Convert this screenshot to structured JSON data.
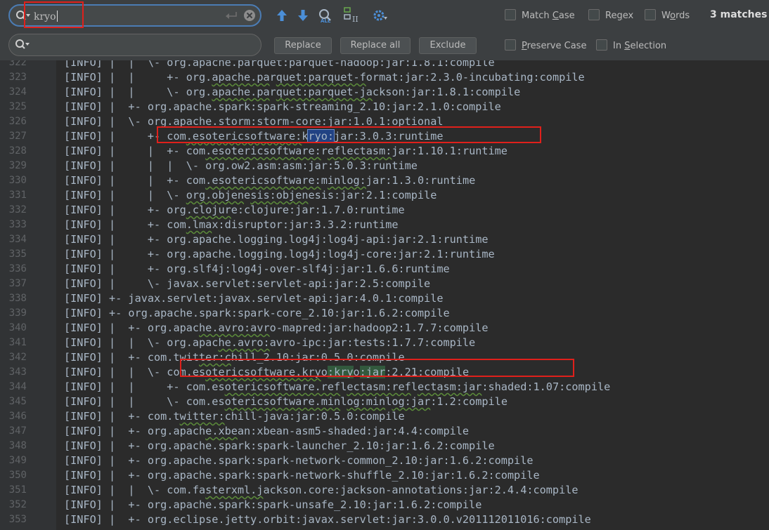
{
  "find": {
    "query": "kryo"
  },
  "buttons": {
    "replace": "Replace",
    "replace_all": "Replace all",
    "exclude": "Exclude"
  },
  "options": {
    "match_case": {
      "pre": "Match ",
      "key": "C",
      "post": "ase"
    },
    "regex": {
      "pre": "Re",
      "key": "g",
      "post": "ex"
    },
    "words": {
      "pre": "W",
      "key": "o",
      "post": "rds"
    },
    "preserve_case": {
      "pre": "",
      "key": "P",
      "post": "reserve Case"
    },
    "in_selection": {
      "pre": "In ",
      "key": "S",
      "post": "election"
    }
  },
  "matches_label": "3 matches",
  "colors": {
    "selection": "#214283",
    "match": "#32593d",
    "highlight_box": "#e0201b",
    "accent": "#4b7cb4"
  },
  "icons": [
    "search-icon",
    "clear-icon",
    "prev-occurrence-icon",
    "next-occurrence-icon",
    "find-all-icon",
    "select-all-occurrences-icon",
    "settings-icon"
  ],
  "lines": [
    {
      "n": "322",
      "t": "[INFO] |  |  \\- org.apache.parquet:parquet-hadoop:jar:1.8.1:compile",
      "sq": []
    },
    {
      "n": "323",
      "t": "[INFO] |  |     +- org.apache.parquet:parquet-format:jar:2.3.0-incubating:compile",
      "sq": [
        [
          23,
          32
        ],
        [
          33,
          47
        ]
      ]
    },
    {
      "n": "324",
      "t": "[INFO] |  |     \\- org.apache.parquet:parquet-jackson:jar:1.8.1:compile",
      "sq": [
        [
          23,
          32
        ],
        [
          33,
          48
        ]
      ]
    },
    {
      "n": "325",
      "t": "[INFO] |  +- org.apache.spark:spark-streaming_2.10:jar:2.1.0:compile",
      "sq": []
    },
    {
      "n": "326",
      "t": "[INFO] |  \\- org.apache.storm:storm-core:jar:1.0.1:optional",
      "sq": []
    },
    {
      "n": "327",
      "t": "[INFO] |     +- com.esotericsoftware:kryo:jar:3.0.3:runtime",
      "sq": [
        [
          19,
          37
        ]
      ],
      "hl": [
        [
          38,
          42,
          "sel"
        ]
      ]
    },
    {
      "n": "328",
      "t": "[INFO] |     |  +- com.esotericsoftware:reflectasm:jar:1.10.1:runtime",
      "sq": [
        [
          22,
          40
        ],
        [
          41,
          51
        ]
      ]
    },
    {
      "n": "329",
      "t": "[INFO] |     |  |  \\- org.ow2.asm:asm:jar:5.0.3:runtime",
      "sq": []
    },
    {
      "n": "330",
      "t": "[INFO] |     |  +- com.esotericsoftware:minlog:jar:1.3.0:runtime",
      "sq": [
        [
          22,
          40
        ],
        [
          41,
          47
        ]
      ]
    },
    {
      "n": "331",
      "t": "[INFO] |     |  \\- org.objenesis:objenesis:jar:2.1:compile",
      "sq": [
        [
          19,
          28
        ],
        [
          29,
          38
        ]
      ]
    },
    {
      "n": "332",
      "t": "[INFO] |     +- org.clojure:clojure:jar:1.7.0:runtime",
      "sq": [
        [
          19,
          26
        ]
      ]
    },
    {
      "n": "333",
      "t": "[INFO] |     +- com.lmax:disruptor:jar:3.3.2:runtime",
      "sq": [
        [
          19,
          23
        ]
      ]
    },
    {
      "n": "334",
      "t": "[INFO] |     +- org.apache.logging.log4j:log4j-api:jar:2.1:runtime",
      "sq": []
    },
    {
      "n": "335",
      "t": "[INFO] |     +- org.apache.logging.log4j:log4j-core:jar:2.1:runtime",
      "sq": []
    },
    {
      "n": "336",
      "t": "[INFO] |     +- org.slf4j:log4j-over-slf4j:jar:1.6.6:runtime",
      "sq": []
    },
    {
      "n": "337",
      "t": "[INFO] |     \\- javax.servlet:servlet-api:jar:2.5:compile",
      "sq": []
    },
    {
      "n": "338",
      "t": "[INFO] +- javax.servlet:javax.servlet-api:jar:4.0.1:compile",
      "sq": []
    },
    {
      "n": "339",
      "t": "[INFO] +- org.apache.spark:spark-core_2.10:jar:1.6.2:compile",
      "sq": []
    },
    {
      "n": "340",
      "t": "[INFO] |  +- org.apache.avro:avro-mapred:jar:hadoop2:1.7.7:compile",
      "sq": [
        [
          21,
          32
        ]
      ]
    },
    {
      "n": "341",
      "t": "[INFO] |  |  \\- org.apache.avro:avro-ipc:jar:tests:1.7.7:compile",
      "sq": [
        [
          24,
          32
        ]
      ]
    },
    {
      "n": "342",
      "t": "[INFO] |  +- com.twitter:chill_2.10:jar:0.5.0:compile",
      "sq": [
        [
          21,
          26
        ]
      ]
    },
    {
      "n": "343",
      "t": "[INFO] |  |  \\- com.esotericsoftware.kryo:kryo:jar:2.21:compile",
      "sq": [
        [
          22,
          40
        ]
      ],
      "hl": [
        [
          41,
          45,
          "match"
        ],
        [
          46,
          50,
          "match"
        ]
      ]
    },
    {
      "n": "344",
      "t": "[INFO] |  |     +- com.esotericsoftware.reflectasm:reflectasm:jar:shaded:1.07:compile",
      "sq": [
        [
          25,
          43
        ],
        [
          44,
          54
        ],
        [
          55,
          65
        ]
      ]
    },
    {
      "n": "345",
      "t": "[INFO] |  |     \\- com.esotericsoftware.minlog:minlog:jar:1.2:compile",
      "sq": [
        [
          25,
          43
        ],
        [
          44,
          50
        ],
        [
          51,
          57
        ]
      ]
    },
    {
      "n": "346",
      "t": "[INFO] |  +- com.twitter:chill-java:jar:0.5.0:compile",
      "sq": [
        [
          18,
          25
        ]
      ]
    },
    {
      "n": "347",
      "t": "[INFO] |  +- org.apache.xbean:xbean-asm5-shaded:jar:4.4:compile",
      "sq": [
        [
          22,
          27
        ]
      ]
    },
    {
      "n": "348",
      "t": "[INFO] |  +- org.apache.spark:spark-launcher_2.10:jar:1.6.2:compile",
      "sq": []
    },
    {
      "n": "349",
      "t": "[INFO] |  +- org.apache.spark:spark-network-common_2.10:jar:1.6.2:compile",
      "sq": []
    },
    {
      "n": "350",
      "t": "[INFO] |  +- org.apache.spark:spark-network-shuffle_2.10:jar:1.6.2:compile",
      "sq": []
    },
    {
      "n": "351",
      "t": "[INFO] |  |  \\- com.fasterxml.jackson.core:jackson-annotations:jar:2.4.4:compile",
      "sq": [
        [
          22,
          31
        ]
      ]
    },
    {
      "n": "352",
      "t": "[INFO] |  +- org.apache.spark:spark-unsafe_2.10:jar:1.6.2:compile",
      "sq": []
    },
    {
      "n": "353",
      "t": "[INFO] |  +- org.eclipse.jetty.orbit:javax.servlet:jar:3.0.0.v201112011016:compile",
      "sq": []
    }
  ]
}
